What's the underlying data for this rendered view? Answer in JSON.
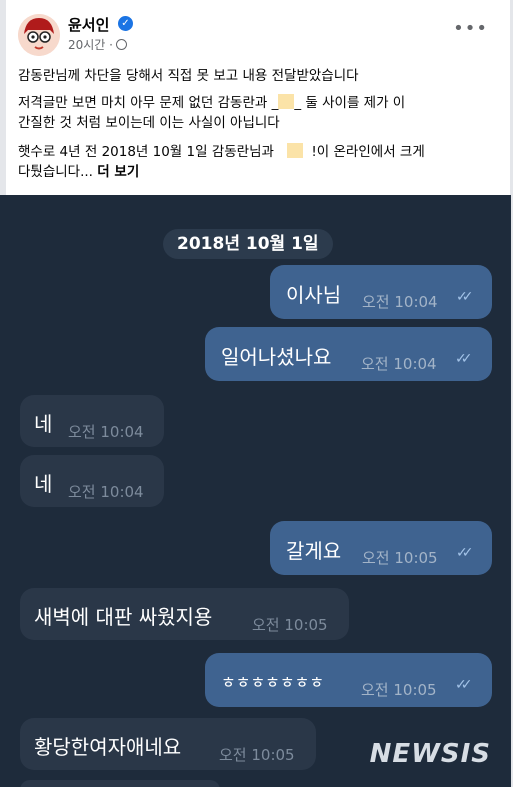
{
  "post": {
    "author": "윤서인",
    "time": "20시간",
    "line1": "감동란님께 차단을 당해서 직접 못 보고 내용 전달받았습니다",
    "line2a": "저격글만 보면 마치 아무 문제 없던 감동란과",
    "line2b": "둘 사이를 제가 이",
    "line3": "간질한 것 처럼 보이는데 이는 사실이 아닙니다",
    "line4a": "햇수로 4년 전 2018년 10월 1일 감동란님과",
    "line4b": "!이 온라인에서 크게",
    "line5": "다퉜습니다...",
    "see_more": "더 보기"
  },
  "chat": {
    "date": "2018년 10월 1일",
    "messages": [
      {
        "dir": "out",
        "text": "이사님",
        "time": "오전 10:04"
      },
      {
        "dir": "out",
        "text": "일어나셨나요",
        "time": "오전 10:04"
      },
      {
        "dir": "in",
        "text": "네",
        "time": "오전 10:04"
      },
      {
        "dir": "in",
        "text": "네",
        "time": "오전 10:04"
      },
      {
        "dir": "out",
        "text": "갈게요",
        "time": "오전 10:05"
      },
      {
        "dir": "in",
        "text": "새벽에 대판 싸웠지용",
        "time": "오전 10:05"
      },
      {
        "dir": "out",
        "text": "ㅎㅎㅎㅎㅎㅎㅎ",
        "time": "오전 10:05"
      },
      {
        "dir": "in",
        "text": "황당한여자애네요",
        "time": "오전 10:05"
      }
    ]
  },
  "watermark": "NEWSIS",
  "colors": {
    "chat_bg": "#1e2b3b",
    "outgoing_bubble": "#3f6390",
    "incoming_bubble": "#2a3748",
    "verified_badge": "#1b74e4"
  },
  "icons": [
    "verified-badge-icon",
    "globe-icon",
    "more-options-icon",
    "read-ticks-icon"
  ]
}
